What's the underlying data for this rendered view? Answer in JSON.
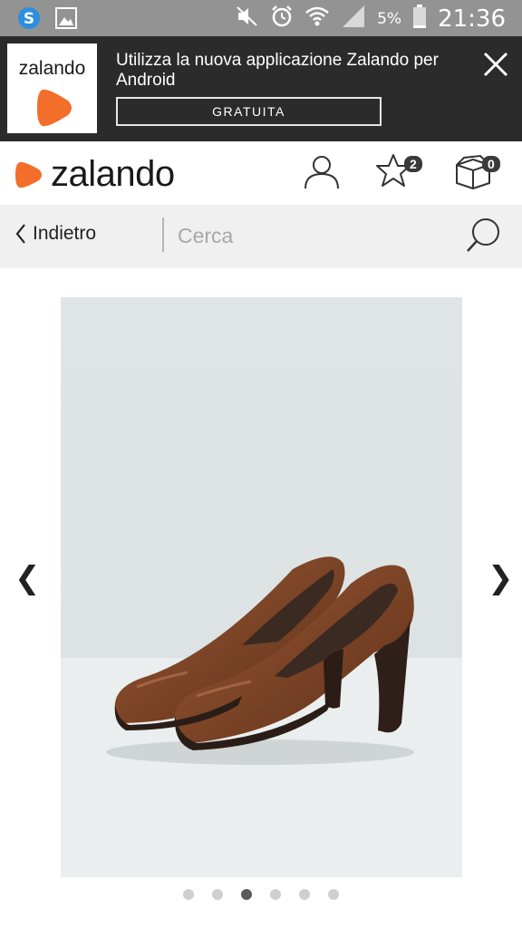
{
  "status_bar": {
    "battery": "5%",
    "time": "21:36",
    "icons": [
      "skype-icon",
      "image-icon",
      "mute-icon",
      "alarm-icon",
      "wifi-icon",
      "signal-icon",
      "battery-icon"
    ]
  },
  "app_banner": {
    "logo_text": "zalando",
    "message": "Utilizza la nuova applicazione Zalando per Android",
    "button_label": "GRATUITA"
  },
  "header": {
    "brand": "zalando",
    "wishlist_count": "2",
    "cart_count": "0"
  },
  "search": {
    "back_label": "Indietro",
    "placeholder": "Cerca"
  },
  "gallery": {
    "image_count": 6,
    "active_index": 3
  },
  "colors": {
    "brand_orange": "#F26E2A",
    "banner_bg": "#2B2B2B",
    "status_bg": "#939393"
  }
}
